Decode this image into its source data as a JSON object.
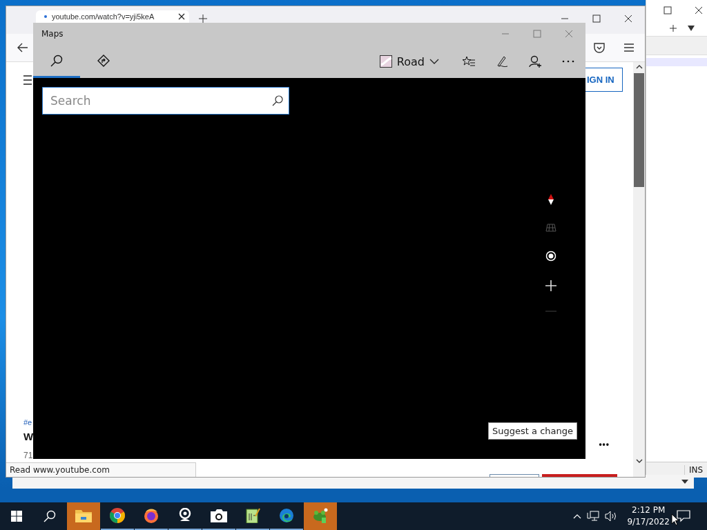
{
  "browser": {
    "tab": {
      "title": "youtube.com/watch?v=yji5keA"
    },
    "sign_in": "IGN IN",
    "page_texts": [
      {
        "kind": "tag",
        "text": "#e"
      },
      {
        "kind": "title",
        "text": "W"
      },
      {
        "kind": "meta",
        "text": "71"
      }
    ],
    "more": "•••",
    "status": "Read www.youtube.com"
  },
  "editor": {
    "status": "INS"
  },
  "maps": {
    "title": "Maps",
    "tabs": [
      {
        "kind": "search",
        "selected": true
      },
      {
        "kind": "directions",
        "selected": false
      }
    ],
    "map_style": "Road",
    "search": {
      "placeholder": "Search"
    },
    "suggest": "Suggest a change",
    "zoom_out_disabled": true
  },
  "taskbar": {
    "apps": [
      {
        "kind": "folder",
        "highlighted": true,
        "running": false
      },
      {
        "kind": "chrome",
        "highlighted": false,
        "running": true
      },
      {
        "kind": "firefox",
        "highlighted": false,
        "running": true
      },
      {
        "kind": "webcam",
        "highlighted": false,
        "running": true
      },
      {
        "kind": "camera",
        "highlighted": false,
        "running": true
      },
      {
        "kind": "notepad",
        "highlighted": false,
        "running": true
      },
      {
        "kind": "edge",
        "highlighted": false,
        "running": true
      },
      {
        "kind": "frog",
        "highlighted": true,
        "running": false
      }
    ],
    "time": "2:12 PM",
    "date": "9/17/2022"
  }
}
